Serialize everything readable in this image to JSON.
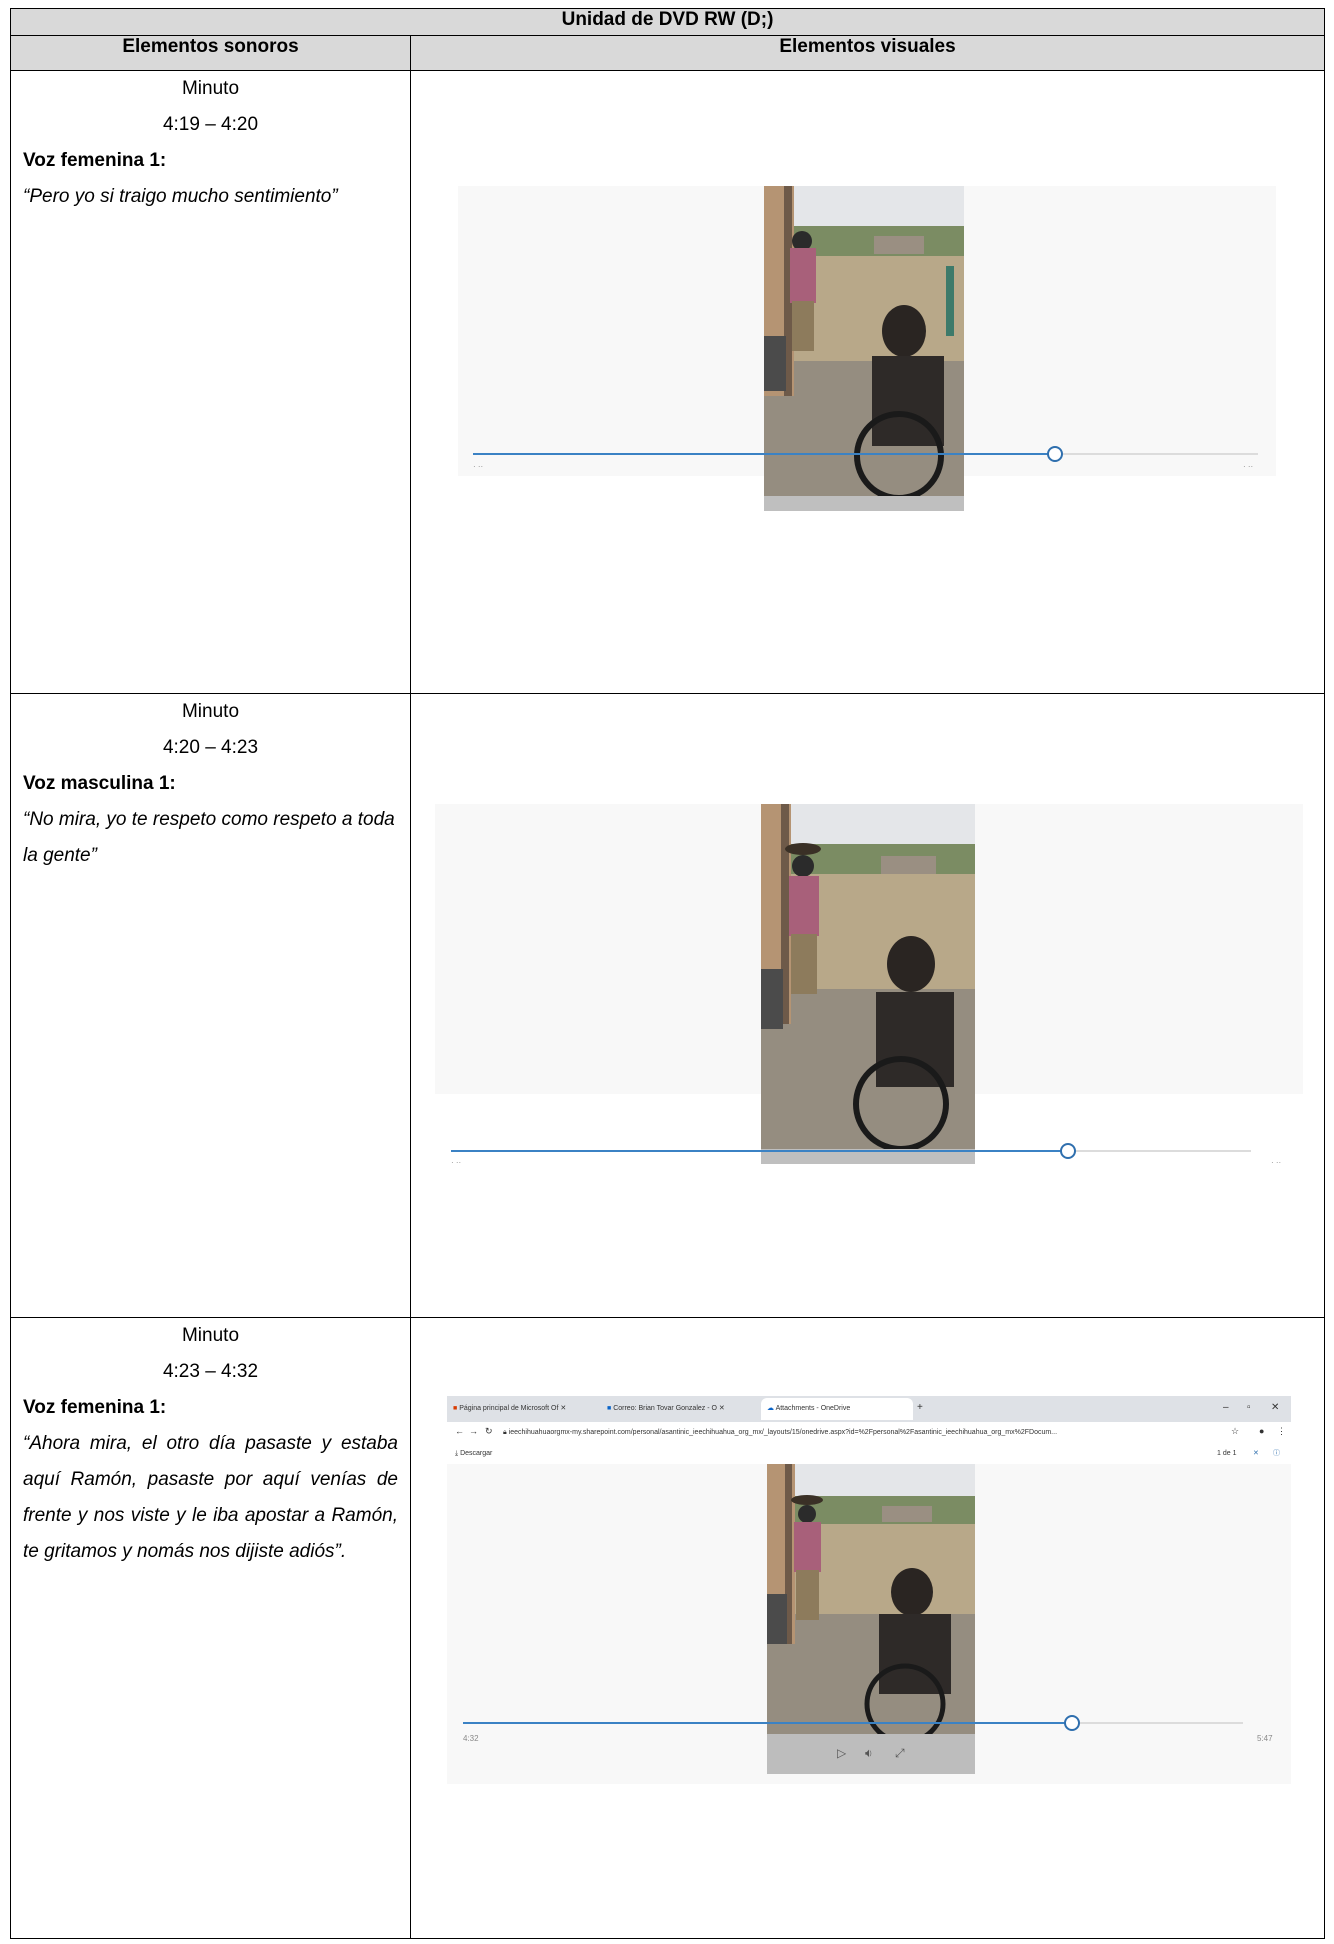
{
  "table": {
    "title": "Unidad de DVD RW (D;)",
    "col_left": "Elementos sonoros",
    "col_right": "Elementos visuales"
  },
  "rows": [
    {
      "minute_label": "Minuto",
      "time_range": "4:19 – 4:20",
      "speaker": "Voz femenina 1:",
      "quote": "“Pero yo si traigo mucho sentimiento”",
      "progress": 0.74
    },
    {
      "minute_label": "Minuto",
      "time_range": "4:20 – 4:23",
      "speaker": "Voz masculina 1:",
      "quote": "“No mira, yo te respeto como respeto a toda la gente”",
      "progress": 0.77
    },
    {
      "minute_label": "Minuto",
      "time_range": "4:23 – 4:32",
      "speaker": "Voz femenina 1:",
      "quote": "“Ahora mira, el otro día pasaste y estaba aquí Ramón, pasaste por aquí venías de frente y nos viste y le iba apostar a Ramón, te gritamos y nomás nos dijiste adiós”.",
      "progress": 0.78,
      "browser": {
        "tab1": "Página principal de Microsoft Of",
        "tab2": "Correo: Brian Tovar Gonzalez - O",
        "tab3": "Attachments - OneDrive",
        "url": "ieechihuahuaorgmx-my.sharepoint.com/personal/asantinic_ieechihuahua_org_mx/_layouts/15/onedrive.aspx?id=%2Fpersonal%2Fasantinic_ieechihuahua_org_mx%2FDocum...",
        "download": "Descargar",
        "page_count": "1 de 1",
        "time_current": "4:32",
        "time_total": "5:47"
      }
    }
  ],
  "icons": {
    "play": "play-icon",
    "volume": "volume-icon",
    "fullscreen": "fullscreen-icon"
  }
}
